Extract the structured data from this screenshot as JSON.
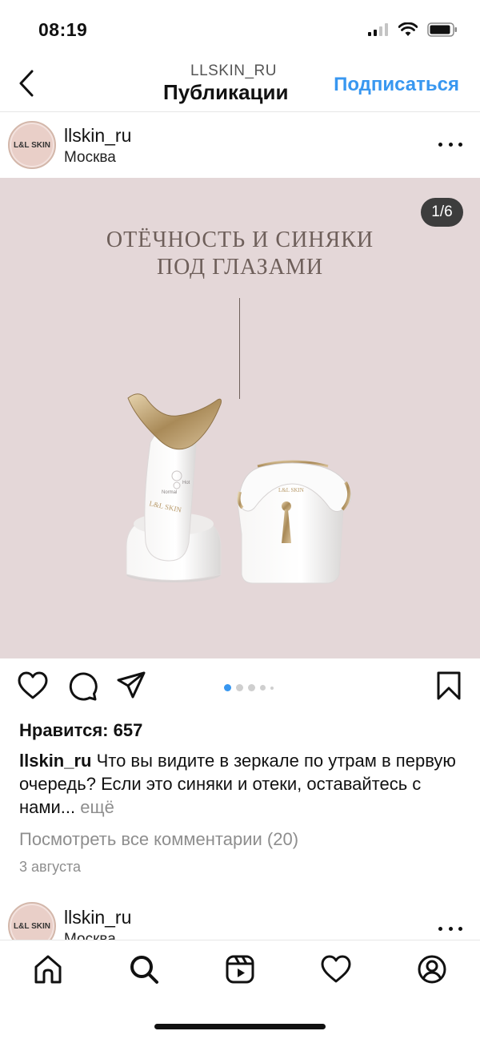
{
  "status_bar": {
    "time": "08:19"
  },
  "nav": {
    "subtitle": "LLSKIN_RU",
    "title": "Публикации",
    "follow_label": "Подписаться"
  },
  "post": {
    "username": "llskin_ru",
    "location": "Москва",
    "avatar_text": "L&L SKIN",
    "counter": "1/6",
    "media": {
      "headline_line1": "ОТЁЧНОСТЬ И СИНЯКИ",
      "headline_line2": "ПОД ГЛАЗАМИ",
      "device_brand": "L&L SKIN",
      "device_label_normal": "Normal",
      "device_label_hot": "Hot"
    },
    "likes": "Нравится: 657",
    "caption_user": "llskin_ru",
    "caption_text": " Что вы видите в зеркале по утрам в первую очередь? Если это синяки и отеки, оставайтесь с нами...",
    "caption_more": " ещё",
    "comments_link": "Посмотреть все комментарии (20)",
    "date": "3 августа",
    "carousel_position": 1,
    "carousel_total": 6
  },
  "next_post": {
    "username": "llskin_ru",
    "location": "Москва",
    "avatar_text": "L&L SKIN"
  },
  "colors": {
    "accent": "#3897f0",
    "media_bg": "#e4d7d8",
    "headline": "#6e5f5a",
    "gold": "#b89a6a"
  },
  "icons": {
    "back": "chevron-left-icon",
    "like": "heart-icon",
    "comment": "comment-icon",
    "share": "paper-plane-icon",
    "save": "bookmark-icon",
    "tabs": [
      "home-icon",
      "search-icon",
      "reels-icon",
      "heart-icon",
      "profile-icon"
    ]
  }
}
